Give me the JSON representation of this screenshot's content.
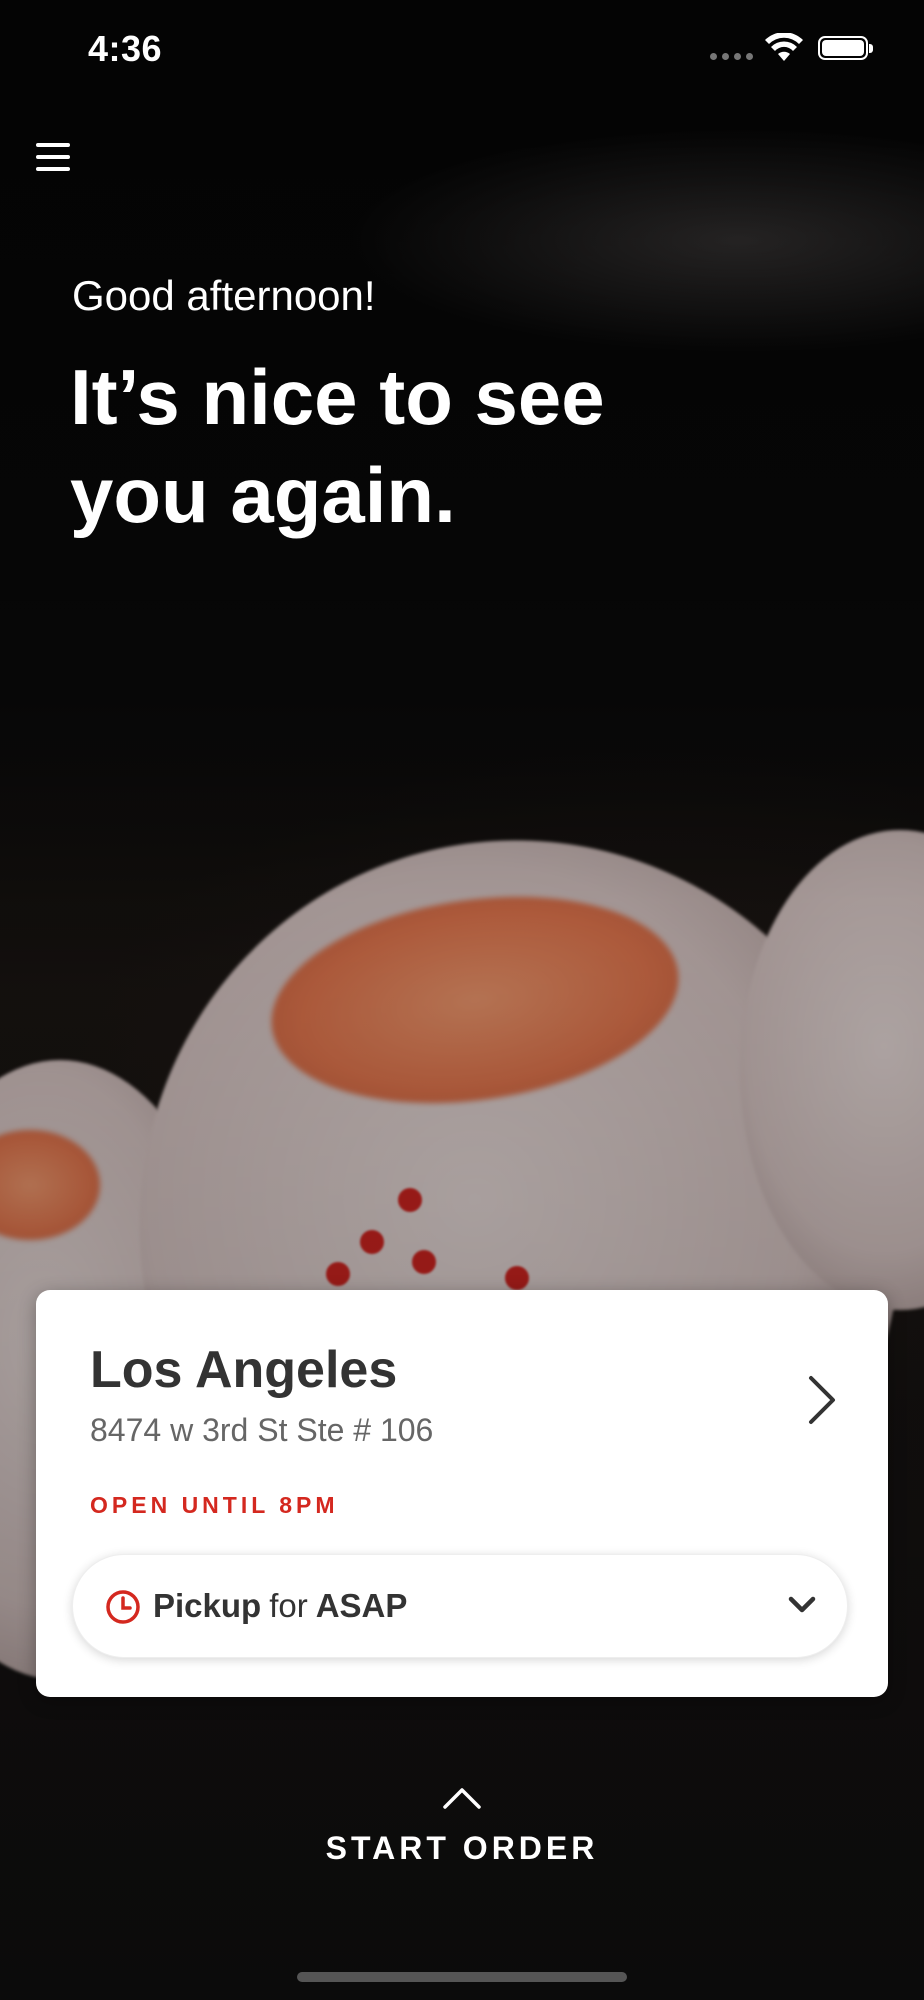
{
  "status_bar": {
    "time": "4:36"
  },
  "greeting": {
    "salutation": "Good afternoon!",
    "headline": "It’s nice to see you again."
  },
  "location": {
    "name": "Los Angeles",
    "address": "8474 w 3rd St Ste # 106",
    "hours": "OPEN UNTIL 8PM"
  },
  "order_mode": {
    "mode": "Pickup",
    "connector": "for",
    "time": "ASAP"
  },
  "start_order": {
    "label": "START ORDER"
  },
  "colors": {
    "accent_red": "#d4281f",
    "card_bg": "#ffffff",
    "text_dark": "#333333"
  },
  "icons": [
    "menu-icon",
    "wifi-icon",
    "battery-icon",
    "chevron-right-icon",
    "clock-icon",
    "chevron-down-icon",
    "chevron-up-icon"
  ]
}
